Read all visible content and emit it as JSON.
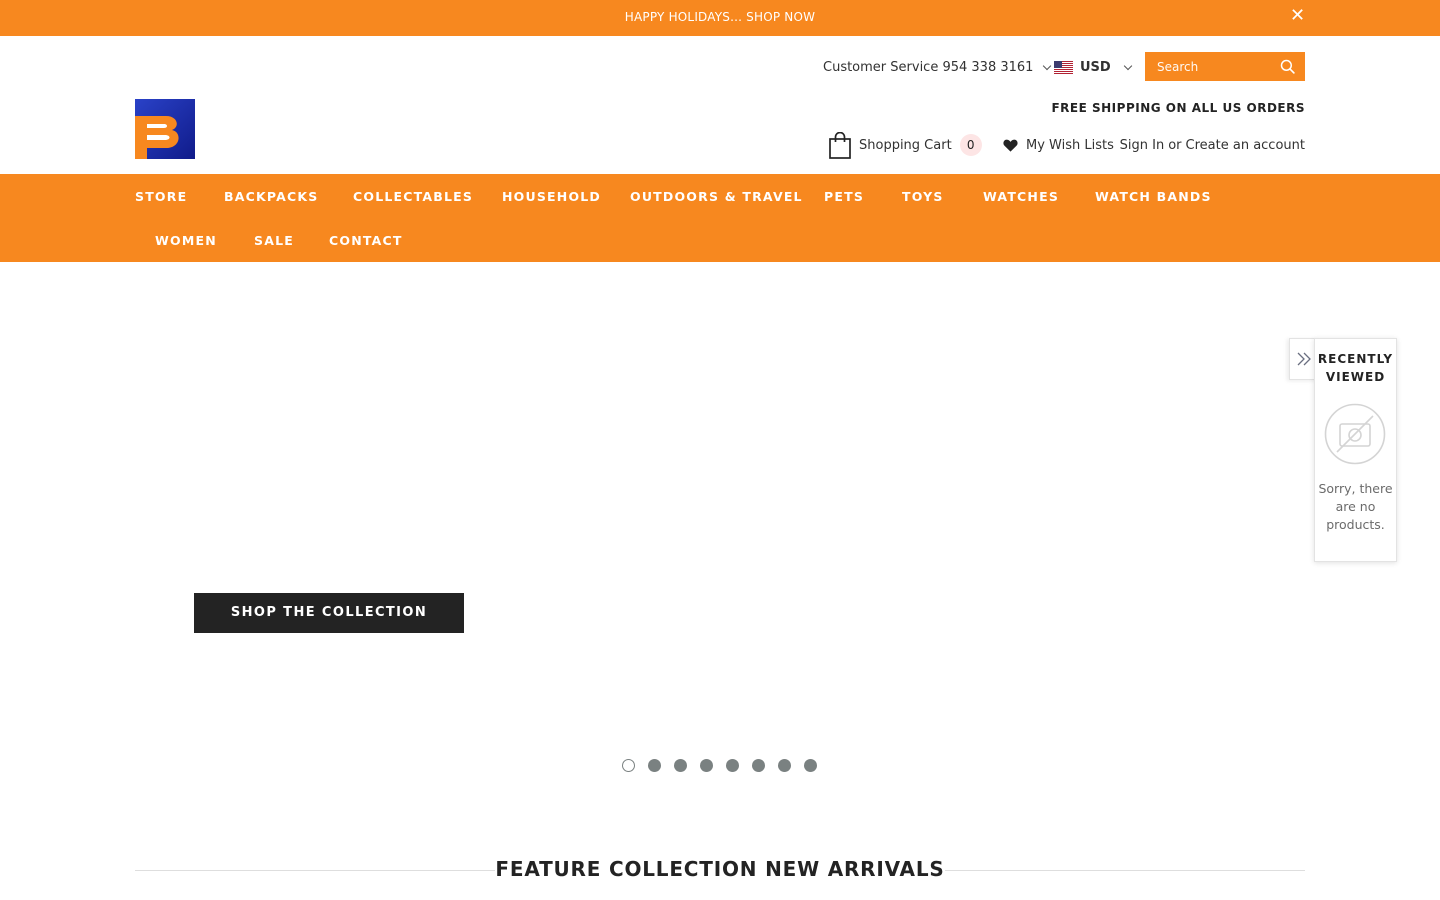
{
  "announcement": {
    "text": "HAPPY HOLIDAYS... SHOP NOW",
    "close_glyph": "✕"
  },
  "header": {
    "customer_service": "Customer Service 954 338 3161",
    "currency": "USD",
    "search_placeholder": "Search",
    "free_shipping": "FREE SHIPPING ON ALL US ORDERS",
    "cart_label": "Shopping Cart",
    "cart_count": "0",
    "wishlist_label": "My Wish Lists",
    "sign_in": "Sign In",
    "or_text": "or",
    "create_account": "Create an account"
  },
  "nav": {
    "items": [
      "STORE",
      "BACKPACKS",
      "COLLECTABLES",
      "HOUSEHOLD",
      "OUTDOORS & TRAVEL",
      "PETS",
      "TOYS",
      "WATCHES",
      "WATCH BANDS",
      "WOMEN",
      "SALE",
      "CONTACT"
    ]
  },
  "hero": {
    "cta_label": "SHOP THE COLLECTION",
    "slide_count": 8,
    "active_slide": 1
  },
  "recently_viewed": {
    "title_line1": "RECENTLY",
    "title_line2": "VIEWED",
    "empty_message": "Sorry, there are no products."
  },
  "feature": {
    "heading": "FEATURE COLLECTION NEW ARRIVALS"
  },
  "colors": {
    "accent": "#f7881f",
    "dark": "#232323",
    "dot": "#7a8181",
    "cart_badge_bg": "#fde5e5"
  },
  "icons": {
    "close": "close-icon",
    "search": "search-icon",
    "cart": "shopping-bag-icon",
    "wishlist": "heart-icon",
    "flag": "us-flag-icon",
    "recently_viewed_toggle": "double-chevron-right-icon",
    "empty": "no-image-icon"
  }
}
